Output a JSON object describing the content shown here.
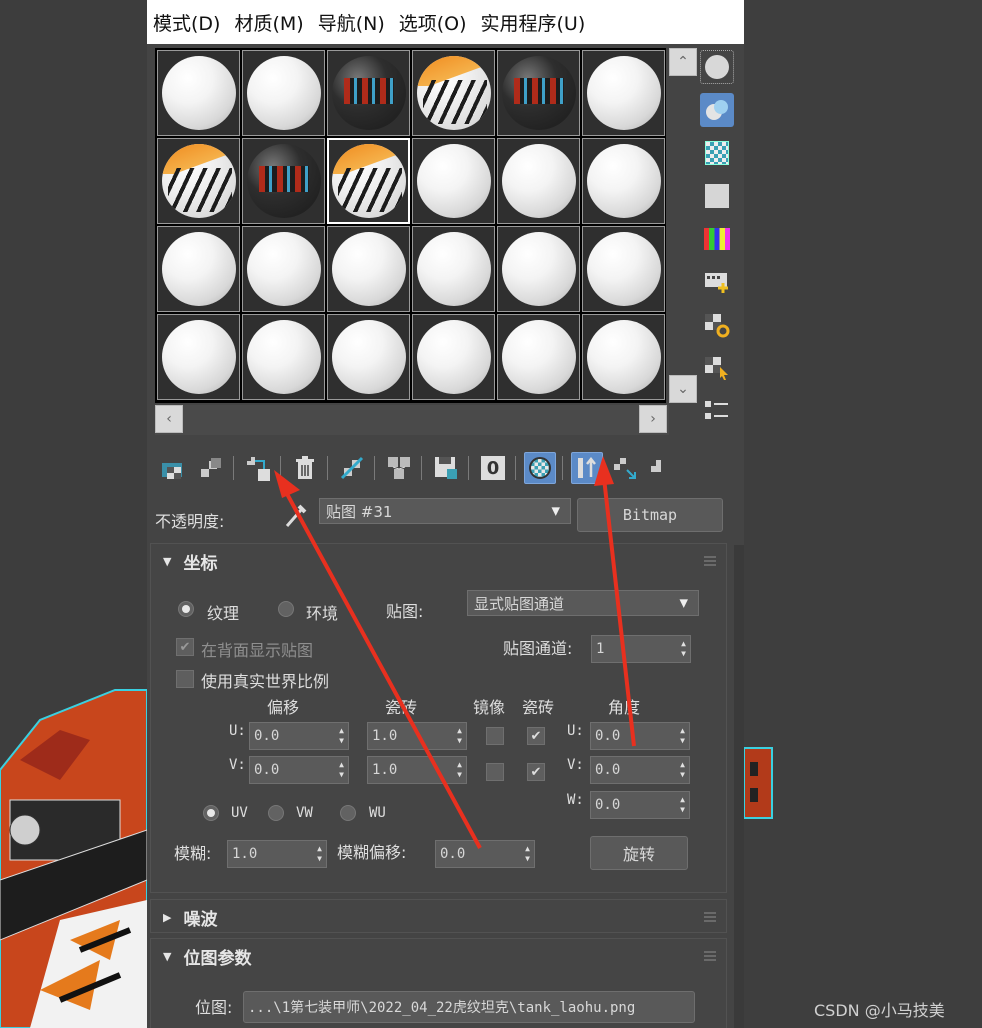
{
  "menu": {
    "items": [
      "模式(D)",
      "材质(M)",
      "导航(N)",
      "选项(O)",
      "实用程序(U)"
    ]
  },
  "slots": {
    "materials": [
      "standard",
      "standard",
      "tank",
      "tiger",
      "tank",
      "standard",
      "tiger",
      "tank",
      "tiger",
      "standard",
      "standard",
      "standard",
      "standard",
      "standard",
      "standard",
      "standard",
      "standard",
      "standard",
      "standard",
      "standard",
      "standard",
      "standard",
      "standard",
      "standard"
    ]
  },
  "opacity": {
    "label": "不透明度:",
    "map_name": "贴图 #31",
    "type_button": "Bitmap"
  },
  "coords": {
    "title": "坐标",
    "texture_radio": "纹理",
    "environ_radio": "环境",
    "mapping_label": "贴图:",
    "mapping_value": "显式贴图通道",
    "show_back_label": "在背面显示贴图",
    "map_channel_label": "贴图通道:",
    "map_channel_value": "1",
    "real_world_label": "使用真实世界比例",
    "offset_header": "偏移",
    "tiling_header": "瓷砖",
    "mirror_header": "镜像",
    "tile_header": "瓷砖",
    "angle_header": "角度",
    "u_label": "U:",
    "v_label": "V:",
    "w_label": "W:",
    "u_offset": "0.0",
    "v_offset": "0.0",
    "u_tiling": "1.0",
    "v_tiling": "1.0",
    "u_angle": "0.0",
    "v_angle": "0.0",
    "w_angle": "0.0",
    "uv_radio": "UV",
    "vw_radio": "VW",
    "wu_radio": "WU",
    "blur_label": "模糊:",
    "blur_value": "1.0",
    "blur_offset_label": "模糊偏移:",
    "blur_offset_value": "0.0",
    "rotate_button": "旋转"
  },
  "noise": {
    "title": "噪波"
  },
  "bitmap_params": {
    "title": "位图参数",
    "bitmap_label": "位图:",
    "bitmap_path": "...\\1第七装甲师\\2022_04_22虎纹坦克\\tank_laohu.png"
  },
  "watermark": "CSDN @小马技美",
  "colors": {
    "accent": "#5b8ac7",
    "arrow": "#e8301f"
  }
}
